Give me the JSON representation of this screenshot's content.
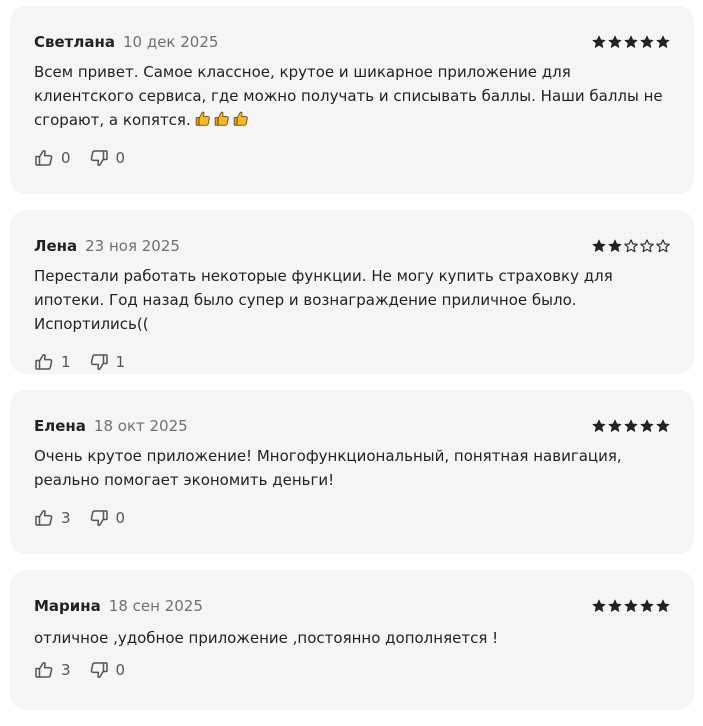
{
  "colors": {
    "card_bg": "#f5f5f5",
    "text": "#222222",
    "muted": "#707070",
    "star": "#222222",
    "emoji_thumb": "#f2b632"
  },
  "reviews": [
    {
      "author": "Светлана",
      "date": "10 дек 2025",
      "rating": 5,
      "text": "Всем привет. Самое классное, крутое и шикарное приложение для клиентского сервиса, где можно получать и списывать баллы. Наши баллы не сгорают, а копятся.",
      "emoji": [
        "thumbs-up-emoji",
        "thumbs-up-emoji",
        "thumbs-up-emoji"
      ],
      "likes": "0",
      "dislikes": "0"
    },
    {
      "author": "Лена",
      "date": "23 ноя 2025",
      "rating": 2,
      "text": "Перестали работать некоторые функции. Не могу купить страховку для ипотеки. Год назад было супер и вознаграждение приличное было. Испортились((",
      "likes": "1",
      "dislikes": "1"
    },
    {
      "author": "Елена",
      "date": "18 окт 2025",
      "rating": 5,
      "text": "Очень крутое приложение! Многофункциональный, понятная навигация, реально помогает экономить деньги!",
      "likes": "3",
      "dislikes": "0"
    },
    {
      "author": "Марина",
      "date": "18 сен 2025",
      "rating": 5,
      "text": "отличное ,удобное приложение ,постоянно дополняется !",
      "likes": "3",
      "dislikes": "0"
    }
  ]
}
